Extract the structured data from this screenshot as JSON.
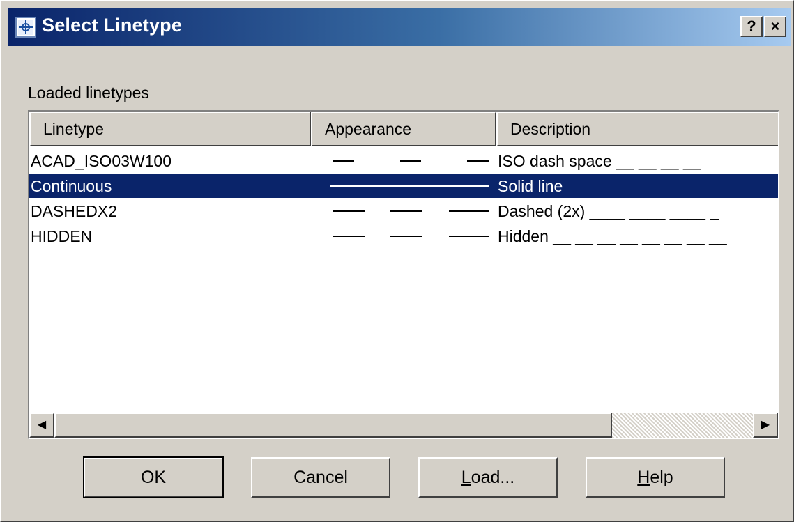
{
  "window": {
    "title": "Select Linetype",
    "help_button": "?",
    "close_button": "×"
  },
  "loaded_label": "Loaded linetypes",
  "table": {
    "columns": [
      "Linetype",
      "Appearance",
      "Description"
    ],
    "rows": [
      {
        "name": "ACAD_ISO03W100",
        "appearance": "dashed-wide",
        "description": "ISO dash space __  __  __  __",
        "selected": false
      },
      {
        "name": "Continuous",
        "appearance": "solid",
        "description": "Solid line",
        "selected": true
      },
      {
        "name": "DASHEDX2",
        "appearance": "dashed-long",
        "description": "Dashed (2x) ____  ____  ____  _",
        "selected": false
      },
      {
        "name": "HIDDEN",
        "appearance": "hidden",
        "description": "Hidden __ __ __ __ __ __ __ __",
        "selected": false
      }
    ]
  },
  "scrollbar": {
    "left_arrow": "◀",
    "right_arrow": "▶"
  },
  "buttons": {
    "ok": "OK",
    "cancel": "Cancel",
    "load_mnemonic": "L",
    "load_rest": "oad...",
    "help_mnemonic": "H",
    "help_rest": "elp"
  },
  "colors": {
    "selection": "#0a246a",
    "face": "#d4d0c8"
  }
}
